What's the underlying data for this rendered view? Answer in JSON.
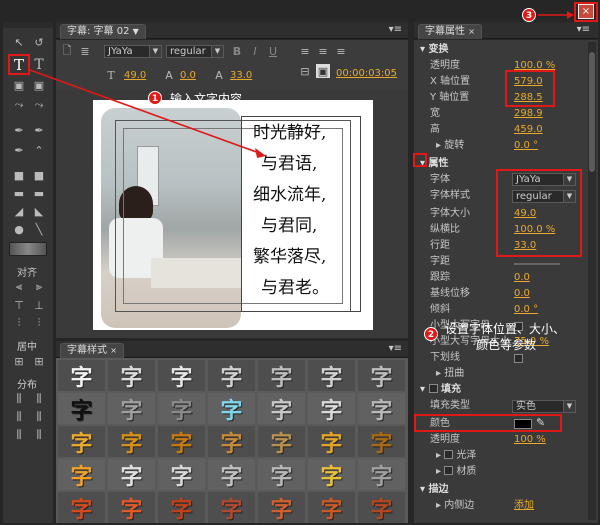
{
  "left_panel": {
    "align_label": "对齐",
    "center_label": "居中",
    "distribute_label": "分布"
  },
  "titler": {
    "tab": "字幕: 字幕 02",
    "font_dropdown": "JYaYa",
    "style_dropdown": "regular",
    "size_value": "49.0",
    "tracking_value": "0.0",
    "leading_value": "33.0",
    "timecode": "00:00:03:05",
    "poem_lines": [
      "时光静好,",
      "与君语,",
      "细水流年,",
      "与君同,",
      "繁华落尽,",
      "与君老。"
    ]
  },
  "styles_panel": {
    "tab": "字幕样式",
    "cell_text": "字",
    "rows": [
      [
        "#f2f2f2",
        "#dcdcdc",
        "#e6e6e6",
        "#cfcfcf",
        "#bcbcbc",
        "#d0d0d0",
        "#bdbdbd"
      ],
      [
        "#111111",
        "#a0a0a0",
        "#8a8a8a",
        "#7fd6ea",
        "#c8c8c8",
        "#d9d9d9",
        "#b8b8b8"
      ],
      [
        "#e8a92e",
        "#d8901c",
        "#c47b12",
        "#c58a3c",
        "#b89150",
        "#e0a42a",
        "#a86a14"
      ],
      [
        "#f0a02a",
        "#e0e0e0",
        "#d8d8d8",
        "#c0c0c0",
        "#b8b8b8",
        "#e8c040",
        "#a0a0a0"
      ],
      [
        "#d24a1e",
        "#e05a2a",
        "#c0401a",
        "#b04a30",
        "#d06030",
        "#c85a28",
        "#b04820"
      ]
    ]
  },
  "props_panel": {
    "tab": "字幕属性",
    "transform": "变换",
    "opacity_label": "透明度",
    "opacity_value": "100.0 %",
    "x_label": "X 轴位置",
    "x_value": "579.0",
    "y_label": "Y 轴位置",
    "y_value": "288.5",
    "width_label": "宽",
    "width_value": "298.9",
    "height_label": "高",
    "height_value": "459.0",
    "rotation_label": "旋转",
    "rotation_value": "0.0 °",
    "properties": "属性",
    "font_label": "字体",
    "font_value": "JYaYa",
    "font_style_label": "字体样式",
    "font_style_value": "regular",
    "font_size_label": "字体大小",
    "font_size_value": "49.0",
    "aspect_label": "纵横比",
    "aspect_value": "100.0 %",
    "leading_label": "行距",
    "leading_value": "33.0",
    "kerning_label": "字距",
    "tracking_label": "跟踪",
    "tracking_value": "0.0",
    "baseline_label": "基线位移",
    "baseline_value": "0.0",
    "slant_label": "倾斜",
    "slant_value": "0.0 °",
    "small_caps_label": "小型大写字母",
    "small_caps_size_label": "小型大写字母大小",
    "small_caps_size_value": "75.0 %",
    "underline_label": "下划线",
    "distort_label": "扭曲",
    "fill_label": "填充",
    "fill_type_label": "填充类型",
    "fill_type_value": "实色",
    "color_label": "颜色",
    "fill_opacity_label": "透明度",
    "fill_opacity_value": "100 %",
    "sheen_label": "光泽",
    "texture_label": "材质",
    "stroke_label": "描边",
    "inner_stroke_label": "内侧边",
    "add_link": "添加"
  },
  "annotations": {
    "a1_num": "1",
    "a1_text": "输入文字内容",
    "a2_num": "2",
    "a2_text": "设置字体位置、大小、",
    "a2_text2": "颜色等参数",
    "a3_num": "3"
  }
}
